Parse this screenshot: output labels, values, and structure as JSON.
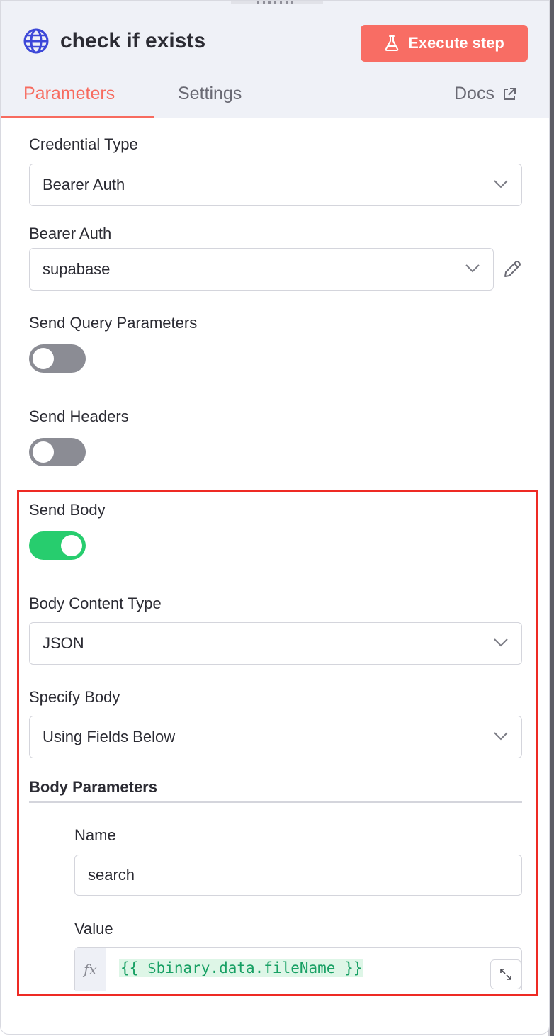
{
  "node": {
    "title": "check if exists",
    "icon": "globe-icon",
    "execute_label": "Execute step"
  },
  "tabs": {
    "parameters": "Parameters",
    "settings": "Settings",
    "docs": "Docs",
    "active": "Parameters"
  },
  "fields": {
    "credential_type": {
      "label": "Credential Type",
      "value": "Bearer Auth"
    },
    "bearer_auth": {
      "label": "Bearer Auth",
      "value": "supabase"
    },
    "send_query": {
      "label": "Send Query Parameters",
      "enabled": false
    },
    "send_headers": {
      "label": "Send Headers",
      "enabled": false
    },
    "send_body": {
      "label": "Send Body",
      "enabled": true
    },
    "body_content_type": {
      "label": "Body Content Type",
      "value": "JSON"
    },
    "specify_body": {
      "label": "Specify Body",
      "value": "Using Fields Below"
    }
  },
  "body_parameters": {
    "title": "Body Parameters",
    "name_label": "Name",
    "name_value": "search",
    "value_label": "Value",
    "fx_label": "fx",
    "value_expression": "{{ $binary.data.fileName }}"
  },
  "colors": {
    "accent": "#f76b5f",
    "execute_button": "#f86d64",
    "toggle_on": "#27cd6e",
    "toggle_off": "#8b8c94",
    "highlight_border": "#ee2a24",
    "expression_text": "#18a064"
  }
}
